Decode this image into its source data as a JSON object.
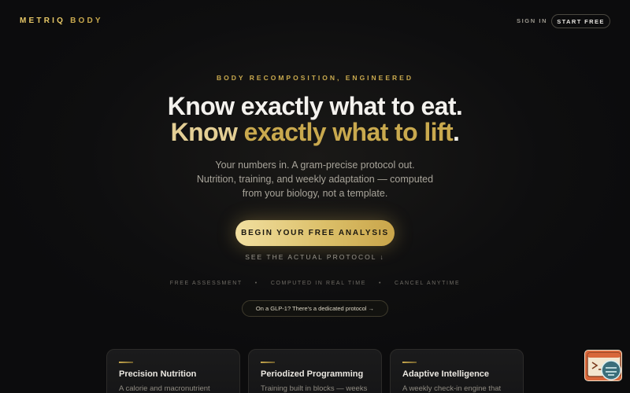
{
  "header": {
    "logo_part1": "METRIQ",
    "logo_part2": "BODY",
    "sign_in": "SIGN IN",
    "start_free": "START FREE"
  },
  "hero": {
    "eyebrow": "BODY RECOMPOSITION, ENGINEERED",
    "headline_line1": "Know exactly what to eat.",
    "headline_line2_a": "Know ",
    "headline_line2_b": "exactly what to lift",
    "headline_line2_c": ".",
    "sub_line1": "Your numbers in. A gram-precise protocol out.",
    "sub_line2": "Nutrition, training, and weekly adaptation — computed",
    "sub_line3": "from your biology, not a template.",
    "cta": "BEGIN YOUR FREE ANALYSIS",
    "see_protocol": "SEE THE ACTUAL PROTOCOL ↓",
    "trust_items": [
      "FREE ASSESSMENT",
      "COMPUTED IN REAL TIME",
      "CANCEL ANYTIME"
    ],
    "trust_separator": "•",
    "glp_link": "On a GLP-1? There's a dedicated protocol →"
  },
  "cards": [
    {
      "title": "Precision Nutrition",
      "desc": "A calorie and macronutrient"
    },
    {
      "title": "Periodized Programming",
      "desc": "Training built in blocks — weeks"
    },
    {
      "title": "Adaptive Intelligence",
      "desc": "A weekly check-in engine that"
    }
  ],
  "colors": {
    "accent_gold": "#c9a94e",
    "accent_gold_light": "#e4cf95",
    "background": "#0d0d0e",
    "widget": "#d8673a"
  },
  "icons": {
    "widget": "terminal-chat-icon"
  }
}
